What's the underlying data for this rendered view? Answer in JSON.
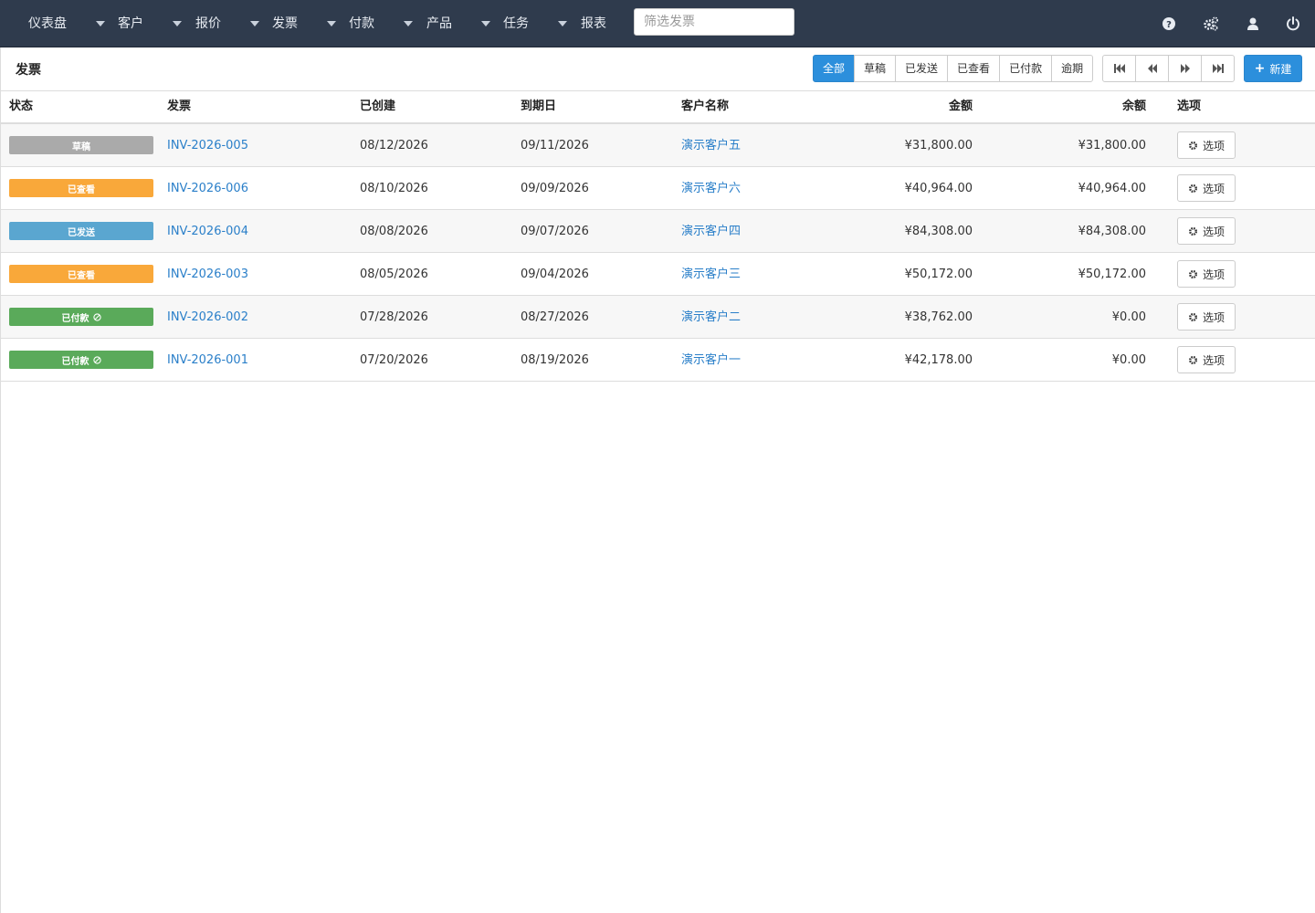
{
  "nav": {
    "items": [
      {
        "label": "仪表盘"
      },
      {
        "label": "客户"
      },
      {
        "label": "报价"
      },
      {
        "label": "发票"
      },
      {
        "label": "付款"
      },
      {
        "label": "产品"
      },
      {
        "label": "任务"
      },
      {
        "label": "报表"
      }
    ],
    "search_placeholder": "筛选发票",
    "icons": [
      "help-icon",
      "settings-icon",
      "user-icon",
      "power-icon"
    ]
  },
  "header": {
    "title": "发票",
    "filters": [
      {
        "label": "全部",
        "active": true
      },
      {
        "label": "草稿",
        "active": false
      },
      {
        "label": "已发送",
        "active": false
      },
      {
        "label": "已查看",
        "active": false
      },
      {
        "label": "已付款",
        "active": false
      },
      {
        "label": "逾期",
        "active": false
      }
    ],
    "new_label": "新建"
  },
  "table": {
    "columns": {
      "status": "状态",
      "invoice": "发票",
      "created": "已创建",
      "due": "到期日",
      "client": "客户名称",
      "amount": "金额",
      "balance": "余额",
      "options": "选项"
    },
    "option_label": "选项",
    "rows": [
      {
        "status": "草稿",
        "status_color": "#aaaaaa",
        "paid_icon": false,
        "invoice": "INV-2026-005",
        "created": "08/12/2026",
        "due": "09/11/2026",
        "client": "演示客户五",
        "amount": "¥31,800.00",
        "balance": "¥31,800.00"
      },
      {
        "status": "已查看",
        "status_color": "#f9a83a",
        "paid_icon": false,
        "invoice": "INV-2026-006",
        "created": "08/10/2026",
        "due": "09/09/2026",
        "client": "演示客户六",
        "amount": "¥40,964.00",
        "balance": "¥40,964.00"
      },
      {
        "status": "已发送",
        "status_color": "#5aa6d0",
        "paid_icon": false,
        "invoice": "INV-2026-004",
        "created": "08/08/2026",
        "due": "09/07/2026",
        "client": "演示客户四",
        "amount": "¥84,308.00",
        "balance": "¥84,308.00"
      },
      {
        "status": "已查看",
        "status_color": "#f9a83a",
        "paid_icon": false,
        "invoice": "INV-2026-003",
        "created": "08/05/2026",
        "due": "09/04/2026",
        "client": "演示客户三",
        "amount": "¥50,172.00",
        "balance": "¥50,172.00"
      },
      {
        "status": "已付款",
        "status_color": "#5aaa5a",
        "paid_icon": true,
        "invoice": "INV-2026-002",
        "created": "07/28/2026",
        "due": "08/27/2026",
        "client": "演示客户二",
        "amount": "¥38,762.00",
        "balance": "¥0.00"
      },
      {
        "status": "已付款",
        "status_color": "#5aaa5a",
        "paid_icon": true,
        "invoice": "INV-2026-001",
        "created": "07/20/2026",
        "due": "08/19/2026",
        "client": "演示客户一",
        "amount": "¥42,178.00",
        "balance": "¥0.00"
      }
    ]
  }
}
